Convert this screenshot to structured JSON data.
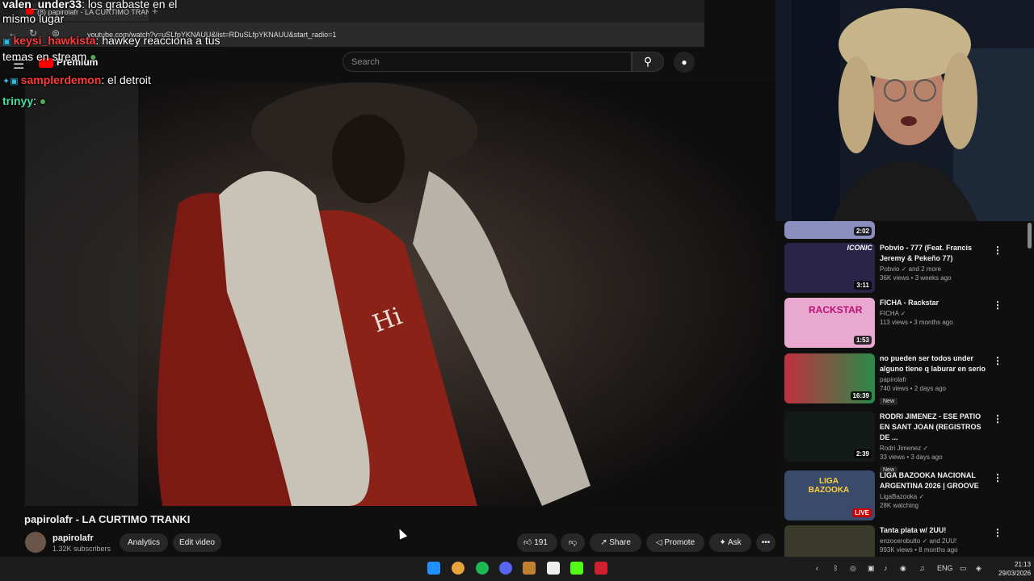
{
  "browser": {
    "tab_title": "(8) papirolafr - LA CURTIMO TRANKI",
    "url": "youtube.com/watch?v=uSLfpYKNAUU&list=RDuSLfpYKNAUU&start_radio=1"
  },
  "header": {
    "logo_text": "Premium",
    "search_placeholder": "Search"
  },
  "chat": [
    {
      "user": "valen_under33",
      "message": ": los grabaste en el mismo lugar",
      "user_color": "#ffffff"
    },
    {
      "user": "keysi_hawkista",
      "message": ": hawkey reacciona a tus temas en stream",
      "user_color": "#ff3b3b"
    },
    {
      "user": "samplerdemon",
      "message": ": el detroit",
      "user_color": "#ff3b3b"
    },
    {
      "user": "trinyy",
      "message": ":",
      "user_color": "#40e0a0"
    }
  ],
  "video": {
    "title": "papirolafr - LA CURTIMO TRANKI",
    "channel": "papirolafr",
    "subscribers": "1.32K subscribers",
    "analytics_label": "Analytics",
    "edit_label": "Edit video",
    "likes": "191",
    "share_label": "Share",
    "promote_label": "Promote",
    "ask_label": "Ask"
  },
  "related": [
    {
      "title": "",
      "channel": "",
      "meta": "",
      "duration": "2:02",
      "badge": "",
      "color": "#8a8fc0"
    },
    {
      "title": "Pobvio - 777 (Feat. Francis Jeremy & Pekeño 77)",
      "channel": "Pobvio",
      "extra": "and 2 more",
      "meta": "36K views • 3 weeks ago",
      "duration": "3:11",
      "badge": "",
      "color": "#3a2a5a",
      "overlay": "ICONIC"
    },
    {
      "title": "FICHA - Rackstar",
      "channel": "FICHA",
      "meta": "113 views • 3 months ago",
      "duration": "1:53",
      "badge": "",
      "color": "#e8a8d0",
      "overlay": "RACKSTAR"
    },
    {
      "title": "no pueden ser todos under alguno tiene q laburar en serio",
      "channel": "papirolafr",
      "meta": "740 views • 2 days ago",
      "duration": "16:39",
      "badge": "New",
      "color": "#c03040"
    },
    {
      "title": "RODRI JIMENEZ - ESE PATIO EN SANT JOAN (REGISTROS DE ...",
      "channel": "Rodri Jimenez",
      "meta": "33 views • 3 days ago",
      "duration": "2:39",
      "badge": "New",
      "color": "#141a18"
    },
    {
      "title": "LIGA BAZOOKA NACIONAL ARGENTINA 2026 | GROOVE",
      "channel": "LigaBazooka",
      "meta": "28K watching",
      "duration": "LIVE",
      "badge": "",
      "color": "#3a4a6a",
      "overlay": "LIGA BAZOOKA"
    },
    {
      "title": "Tanta plata w/ 2UU!",
      "channel": "enzocerobulto",
      "extra": "and 2UU!",
      "meta": "993K views • 8 months ago",
      "duration": "",
      "badge": "",
      "color": "#3a3a2a"
    }
  ],
  "taskbar": {
    "language": "ENG",
    "time": "21:13",
    "date": "29/03/2026"
  },
  "colors": {
    "accent": "#ff0000",
    "bg": "#0f0f0f"
  }
}
